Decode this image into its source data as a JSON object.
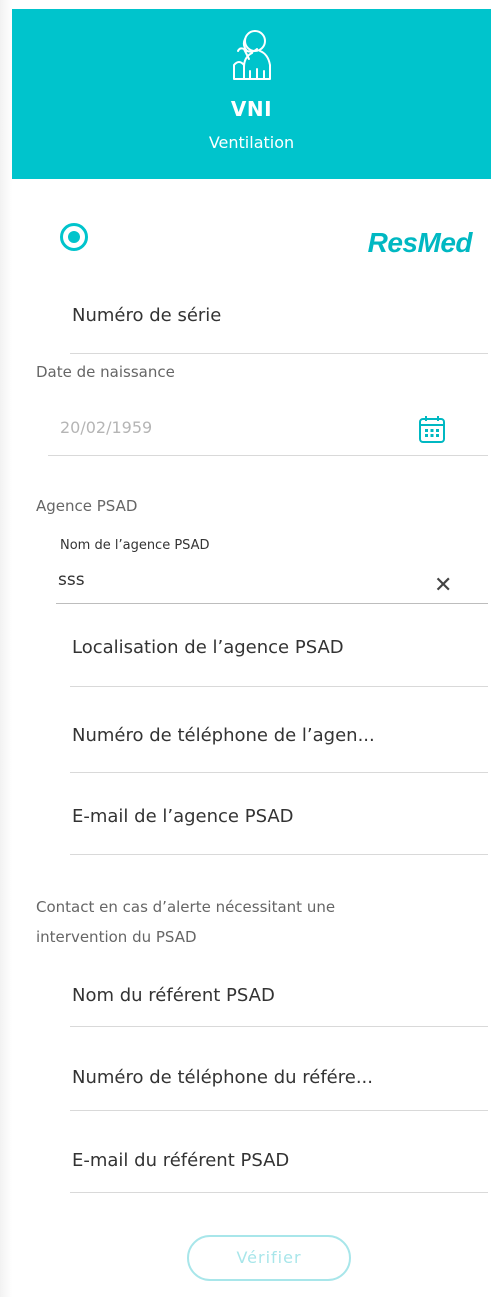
{
  "header": {
    "title": "VNI",
    "subtitle": "Ventilation",
    "icon": "patient-ventilation-icon",
    "color": "#00c4cc"
  },
  "brand": "ResMed",
  "serial": {
    "placeholder": "Numéro de série"
  },
  "birth": {
    "label": "Date de naissance",
    "value": "20/02/1959",
    "icon": "calendar-icon"
  },
  "agency": {
    "section_label": "Agence PSAD",
    "name_label": "Nom de l’agence PSAD",
    "name_value": "sss",
    "location_placeholder": "Localisation de l’agence PSAD",
    "phone_placeholder": "Numéro de téléphone de l’agen...",
    "email_placeholder": "E-mail de l’agence PSAD"
  },
  "contact": {
    "section_label_line1": "Contact en cas d’alerte nécessitant une",
    "section_label_line2": "intervention du PSAD",
    "name_placeholder": "Nom du référent PSAD",
    "phone_placeholder": "Numéro de téléphone du référe...",
    "email_placeholder": "E-mail du référent PSAD"
  },
  "actions": {
    "verify": "Vérifier"
  }
}
